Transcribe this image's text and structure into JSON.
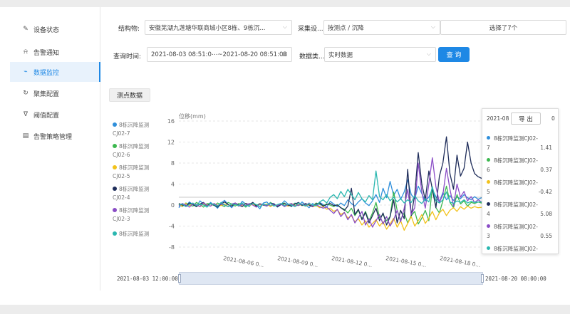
{
  "sidebar": {
    "items": [
      {
        "label": "设备状态",
        "icon": "device-icon",
        "glyph": "✎",
        "active": false
      },
      {
        "label": "告警通知",
        "icon": "bell-icon",
        "glyph": "⍾",
        "active": false
      },
      {
        "label": "数据监控",
        "icon": "pulse-icon",
        "glyph": "⌁",
        "active": true
      },
      {
        "label": "聚集配置",
        "icon": "refresh-icon",
        "glyph": "↻",
        "active": false
      },
      {
        "label": "阈值配置",
        "icon": "filter-icon",
        "glyph": "∇",
        "active": false
      },
      {
        "label": "告警策略管理",
        "icon": "document-icon",
        "glyph": "▤",
        "active": false
      }
    ]
  },
  "filters": {
    "structure_label": "结构物:",
    "structure_value": "安徽芜湖九莲塘华联商城小区8栋、9栋沉...",
    "device_label": "采集设...",
    "device_value": "按测点 / 沉降",
    "selected_value": "选择了7个",
    "time_label": "查询时间:",
    "time_value": "2021-08-03 08:51:0⋯~2021-08-20 08:51:03",
    "datatype_label": "数据类...",
    "datatype_value": "实时数据",
    "query_button": "查 询"
  },
  "tab_label": "测点数据",
  "legend": [
    {
      "line1": "8栋沉降监测",
      "line2": "CJ02-7",
      "color": "#2f8fdb"
    },
    {
      "line1": "8栋沉降监测",
      "line2": "CJ02-6",
      "color": "#3cb84f"
    },
    {
      "line1": "8栋沉降监测",
      "line2": "CJ02-5",
      "color": "#f2c21b"
    },
    {
      "line1": "8栋沉降监测",
      "line2": "CJ02-4",
      "color": "#1f2d5a"
    },
    {
      "line1": "8栋沉降监测",
      "line2": "CJ02-3",
      "color": "#8a4dc6"
    },
    {
      "line1": "8栋沉降监测",
      "line2": "",
      "color": "#2ab7b0"
    }
  ],
  "tooltip": {
    "header": "2021-08",
    "header_tail": "0",
    "export_label": "导 出",
    "rows": [
      {
        "name1": "8栋沉降监测CJ02-",
        "name2": "7",
        "value": "1.41",
        "color": "#2f8fdb"
      },
      {
        "name1": "8栋沉降监测CJ02-",
        "name2": "6",
        "value": "0.37",
        "color": "#3cb84f"
      },
      {
        "name1": "8栋沉降监测CJ02-",
        "name2": "5",
        "value": "-0.42",
        "color": "#f2c21b"
      },
      {
        "name1": "8栋沉降监测CJ02-",
        "name2": "4",
        "value": "5.08",
        "color": "#1f2d5a"
      },
      {
        "name1": "8栋沉降监测CJ02-",
        "name2": "3",
        "value": "0.55",
        "color": "#8a4dc6"
      },
      {
        "name1": "8栋沉降监测CJ02-",
        "name2": "",
        "value": "",
        "color": "#2ab7b0"
      }
    ]
  },
  "zoom": {
    "start_label": "2021-08-03 12:00:00",
    "end_label": "2021-08-20 08:00:00"
  },
  "chart_data": {
    "type": "line",
    "ylabel": "位移(mm)",
    "ylim": [
      -8,
      16
    ],
    "yticks": [
      "16",
      "12",
      "8",
      "4",
      "0",
      "-4",
      "-8"
    ],
    "xticks": [
      "2021-08-06 0...",
      "2021-08-09 0...",
      "2021-08-12 0...",
      "2021-08-15 0...",
      "2021-08-18 0..."
    ],
    "grid": true,
    "reference_line": 1.5,
    "series": [
      {
        "name": "8栋沉降监测CJ02-7",
        "color": "#2f8fdb",
        "values": [
          -0.5,
          0.3,
          -0.2,
          0.6,
          0.1,
          -0.3,
          0.8,
          0.2,
          -0.4,
          0.5,
          0.0,
          -0.6,
          0.4,
          0.9,
          0.1,
          -0.5,
          0.3,
          -0.2,
          0.7,
          0.2,
          -0.3,
          0.5,
          0.0,
          -0.7,
          0.4,
          0.6,
          -0.2,
          0.3,
          -0.4,
          0.1,
          0.8,
          0.2,
          -0.3,
          0.4,
          -0.1,
          0.6,
          0.0,
          -0.5,
          0.3,
          -0.2,
          0.5,
          0.1,
          -0.4,
          0.7,
          0.2,
          -0.3,
          0.4,
          -0.1,
          1.0,
          0.3,
          -0.2,
          0.6,
          1.2,
          0.4,
          -0.1,
          0.8,
          2.0,
          0.5,
          3.2,
          1.4,
          4.5,
          1.8,
          3.0,
          1.1,
          2.5,
          4.8,
          2.0,
          1.2,
          3.6,
          2.2,
          0.8,
          1.5,
          3.0,
          1.6,
          0.6,
          2.4,
          1.0,
          1.8,
          0.9,
          1.5,
          1.2,
          2.0,
          1.4,
          1.0,
          1.6,
          1.1,
          1.41
        ]
      },
      {
        "name": "8栋沉降监测CJ02-6",
        "color": "#3cb84f",
        "values": [
          0.2,
          -0.3,
          0.4,
          0.0,
          -0.2,
          0.5,
          0.1,
          -0.4,
          0.3,
          0.2,
          -0.1,
          0.4,
          0.0,
          -0.3,
          0.5,
          0.2,
          -0.2,
          0.3,
          0.1,
          -0.4,
          0.2,
          0.4,
          -0.1,
          0.3,
          0.0,
          -0.2,
          0.5,
          0.1,
          -0.3,
          0.2,
          0.4,
          -0.2,
          0.1,
          0.3,
          -0.1,
          0.2,
          0.0,
          0.3,
          -0.2,
          0.4,
          0.1,
          -0.1,
          0.2,
          0.0,
          -0.3,
          0.1,
          -0.5,
          -0.8,
          -1.5,
          -0.6,
          -2.0,
          -1.0,
          -2.6,
          -1.2,
          -3.0,
          -1.5,
          0.5,
          -2.4,
          -1.8,
          -3.0,
          -2.2,
          2.5,
          -1.0,
          -2.8,
          -1.5,
          -3.4,
          -2.0,
          -1.2,
          -3.6,
          -2.5,
          -1.0,
          -3.0,
          3.5,
          -0.5,
          -1.5,
          0.8,
          3.6,
          0.5,
          -0.5,
          2.0,
          0.2,
          0.8,
          -0.2,
          0.5,
          0.3,
          0.6,
          0.37
        ]
      },
      {
        "name": "8栋沉降监测CJ02-5",
        "color": "#f2c21b",
        "values": [
          0.1,
          -0.2,
          0.3,
          -0.1,
          0.2,
          0.0,
          -0.3,
          0.2,
          0.1,
          -0.2,
          0.3,
          0.0,
          -0.1,
          0.2,
          -0.3,
          0.1,
          0.2,
          -0.2,
          0.0,
          0.3,
          -0.1,
          0.2,
          -0.2,
          0.1,
          0.0,
          0.2,
          -0.3,
          0.1,
          -0.1,
          0.2,
          0.0,
          -0.2,
          0.3,
          -0.1,
          0.1,
          0.0,
          -0.2,
          0.1,
          -0.3,
          -0.1,
          -0.5,
          -0.3,
          -0.8,
          -0.6,
          -1.2,
          -0.9,
          -1.8,
          -1.4,
          -2.5,
          -2.0,
          -3.2,
          -2.6,
          -3.8,
          -3.0,
          -4.2,
          -3.5,
          -2.8,
          -4.0,
          -3.2,
          -4.6,
          -3.6,
          -2.5,
          -4.2,
          -3.0,
          -4.8,
          -3.5,
          -2.2,
          -4.0,
          -3.0,
          -1.8,
          -3.5,
          -2.5,
          -1.2,
          -2.8,
          -1.5,
          -0.8,
          -2.0,
          -1.0,
          -0.5,
          -1.2,
          -0.3,
          -0.8,
          -0.2,
          -0.6,
          -0.3,
          -0.5,
          -0.42
        ]
      },
      {
        "name": "8栋沉降监测CJ02-4",
        "color": "#1f2d5a",
        "values": [
          0.3,
          0.0,
          -0.2,
          0.4,
          0.1,
          -0.3,
          0.2,
          0.5,
          -0.1,
          0.3,
          0.0,
          -0.4,
          0.2,
          0.6,
          0.1,
          -0.2,
          0.4,
          0.0,
          -0.3,
          0.3,
          0.1,
          0.5,
          -0.2,
          0.2,
          0.0,
          -0.1,
          0.4,
          0.2,
          -0.3,
          0.1,
          0.3,
          0.0,
          -0.2,
          0.2,
          0.5,
          -0.1,
          0.3,
          0.0,
          -0.3,
          0.2,
          0.4,
          -0.2,
          0.1,
          0.3,
          -0.1,
          0.0,
          -0.5,
          -1.0,
          -0.2,
          3.2,
          -1.8,
          -0.8,
          -2.8,
          -1.4,
          -3.4,
          -2.0,
          -0.6,
          -3.0,
          -1.5,
          -3.8,
          -2.2,
          1.0,
          -3.4,
          -1.0,
          -2.6,
          6.8,
          -2.0,
          2.0,
          10.0,
          4.0,
          1.0,
          6.5,
          3.0,
          -0.5,
          5.5,
          8.0,
          13.0,
          6.0,
          3.0,
          9.5,
          5.5,
          7.0,
          12.0,
          8.0,
          6.0,
          5.4,
          5.08
        ]
      },
      {
        "name": "8栋沉降监测CJ02-3",
        "color": "#8a4dc6",
        "values": [
          -0.2,
          0.3,
          0.0,
          -0.4,
          0.2,
          0.1,
          -0.3,
          0.4,
          0.0,
          -0.2,
          0.3,
          -0.1,
          0.2,
          0.0,
          -0.3,
          0.2,
          0.4,
          -0.2,
          0.1,
          -0.1,
          0.3,
          0.0,
          -0.4,
          0.2,
          0.1,
          -0.2,
          0.3,
          0.0,
          -0.1,
          0.2,
          -0.3,
          0.1,
          0.3,
          -0.2,
          0.0,
          0.2,
          -0.1,
          0.4,
          -0.2,
          0.1,
          -0.3,
          -0.6,
          -0.4,
          -1.0,
          -1.6,
          -0.8,
          -2.2,
          -1.4,
          -2.8,
          -1.8,
          -3.4,
          -2.4,
          -1.2,
          -3.8,
          -2.6,
          -4.2,
          -3.0,
          -1.8,
          -3.6,
          -2.2,
          -4.0,
          -2.8,
          -1.0,
          -3.2,
          -0.6,
          3.0,
          -1.8,
          -0.5,
          8.0,
          2.5,
          -0.6,
          4.0,
          9.0,
          3.5,
          0.5,
          2.0,
          7.0,
          3.0,
          -0.2,
          4.0,
          1.5,
          2.6,
          0.8,
          1.6,
          0.5,
          1.0,
          0.55
        ]
      },
      {
        "name": "8栋沉降监测",
        "color": "#2ab7b0",
        "values": [
          0.0,
          0.2,
          -0.3,
          0.1,
          0.4,
          -0.1,
          0.2,
          0.0,
          -0.4,
          0.3,
          0.1,
          -0.2,
          0.5,
          0.0,
          -0.3,
          0.2,
          0.1,
          -0.1,
          0.4,
          -0.2,
          0.0,
          0.3,
          0.1,
          -0.3,
          0.2,
          0.0,
          0.4,
          -0.2,
          0.1,
          0.3,
          -0.1,
          0.2,
          0.0,
          -0.3,
          0.4,
          0.1,
          -0.2,
          0.3,
          0.0,
          -0.1,
          0.6,
          1.0,
          0.4,
          1.5,
          2.0,
          1.2,
          2.6,
          1.6,
          3.0,
          2.0,
          1.0,
          2.4,
          1.2,
          0.6,
          1.8,
          1.0,
          6.5,
          1.6,
          1.0,
          2.0,
          0.8,
          1.5,
          0.6,
          1.2,
          0.4,
          1.0,
          0.5,
          1.8,
          0.8,
          0.3,
          1.2,
          0.6,
          3.5,
          0.8,
          0.4,
          1.0,
          2.5,
          0.6,
          0.3,
          0.8,
          0.5,
          1.0,
          0.4,
          0.7,
          0.5,
          0.6,
          0.6
        ]
      }
    ]
  }
}
